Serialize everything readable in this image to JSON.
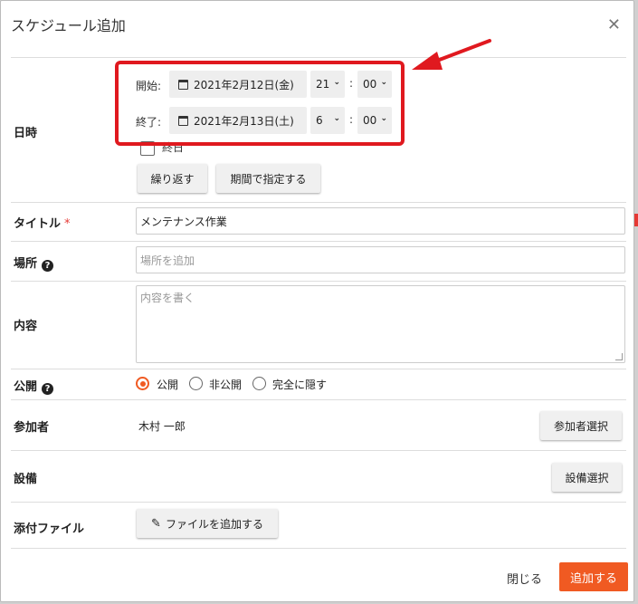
{
  "dialog": {
    "title": "スケジュール追加"
  },
  "datetime": {
    "label": "日時",
    "start_label": "開始:",
    "start_date": "2021年2月12日(金)",
    "start_hour": "21",
    "start_minute": "00",
    "end_label": "終了:",
    "end_date": "2021年2月13日(土)",
    "end_hour": "6",
    "end_minute": "00",
    "colon": ":",
    "allday_label": "終日",
    "repeat_button": "繰り返す",
    "period_button": "期間で指定する"
  },
  "title_field": {
    "label": "タイトル",
    "required_mark": "*",
    "value": "メンテナンス作業"
  },
  "location": {
    "label": "場所",
    "placeholder": "場所を追加"
  },
  "content": {
    "label": "内容",
    "placeholder": "内容を書く"
  },
  "visibility": {
    "label": "公開",
    "options": [
      "公開",
      "非公開",
      "完全に隠す"
    ],
    "selected": "公開"
  },
  "participants": {
    "label": "参加者",
    "value": "木村 一郎",
    "button": "参加者選択"
  },
  "equipment": {
    "label": "設備",
    "button": "設備選択"
  },
  "attachment": {
    "label": "添付ファイル",
    "button": "ファイルを追加する"
  },
  "footer": {
    "close": "閉じる",
    "submit": "追加する"
  },
  "colors": {
    "accent": "#f05a22",
    "highlight": "#e0191f"
  }
}
